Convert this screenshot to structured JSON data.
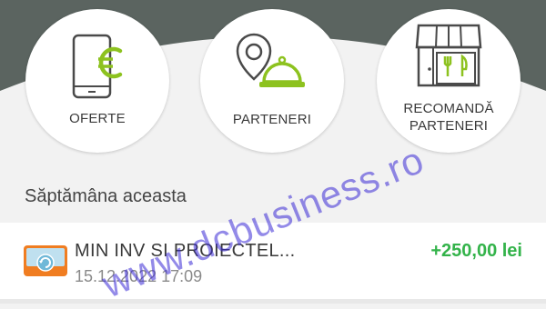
{
  "colors": {
    "band": "#5b6460",
    "accent": "#8dc21f",
    "positive": "#33b34a",
    "watermark": "#3a2ad6"
  },
  "shortcuts": [
    {
      "label_lines": [
        "OFERTE"
      ],
      "icon": "phone-euro-icon"
    },
    {
      "label_lines": [
        "PARTENERI"
      ],
      "icon": "location-dish-icon"
    },
    {
      "label_lines": [
        "RECOMANDĂ",
        "PARTENERI"
      ],
      "icon": "storefront-icon"
    }
  ],
  "section_title": "Săptămâna aceasta",
  "transaction": {
    "name": "MIN INV SI PROIECTEL...",
    "date": "15.12.2022 17:09",
    "amount": "+250,00 lei",
    "icon": "bank-transfer-icon"
  },
  "watermark": "www.dcbusiness.ro"
}
